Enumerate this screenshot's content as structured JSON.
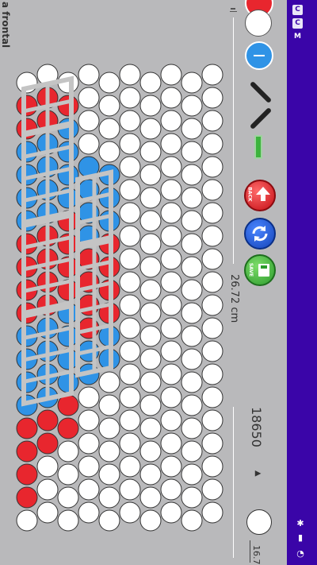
{
  "header": {
    "title_fragment": "a frontal"
  },
  "measurements": {
    "length": "26.72 cm",
    "cell_type": "18650",
    "secondary_value": "16.7"
  },
  "toolbar": {
    "back_label": "BACK",
    "save_label": "SAVE",
    "dropdown_arrow": "▲"
  },
  "status_bar": {
    "notif_1": "C",
    "notif_2": "C",
    "notif_3": "M"
  },
  "colors": {
    "background": "#b9b9bb",
    "status_bar": "#3a05a8",
    "cell_red": "#e8262e",
    "cell_blue": "#2f93e6",
    "cell_white": "#ffffff",
    "connector": "#c4c4c4",
    "back_button": "#d81f26",
    "refresh_button": "#1e5bd6",
    "save_button": "#3cb33c"
  }
}
